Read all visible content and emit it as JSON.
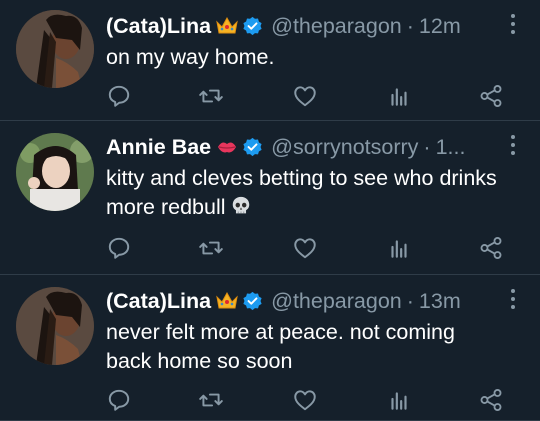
{
  "tweets": [
    {
      "name": "(Cata)Lina",
      "name_emoji": "crown-emoji",
      "handle": "@theparagon",
      "dot": "·",
      "time": "12m",
      "text": "on my way home.",
      "avatar": "avatar-woman-braids"
    },
    {
      "name": "Annie Bae",
      "name_emoji": "kiss-lips-emoji",
      "handle": "@sorrynotsorry",
      "dot": "·",
      "time": "1...",
      "text": "kitty and cleves betting to see who drinks more redbull",
      "text_emoji": "skull-emoji",
      "avatar": "avatar-woman-bob"
    },
    {
      "name": "(Cata)Lina",
      "name_emoji": "crown-emoji",
      "handle": "@theparagon",
      "dot": "·",
      "time": "13m",
      "text": "never felt more at peace. not coming back home so soon",
      "avatar": "avatar-woman-braids"
    }
  ],
  "colors": {
    "background": "#15202b",
    "secondary_text": "#8899a6",
    "verified": "#1d9bf0",
    "divider": "#2f3c48"
  },
  "icons": [
    "reply-icon",
    "retweet-icon",
    "like-icon",
    "analytics-icon",
    "share-icon",
    "verified-badge-icon",
    "more-icon"
  ]
}
